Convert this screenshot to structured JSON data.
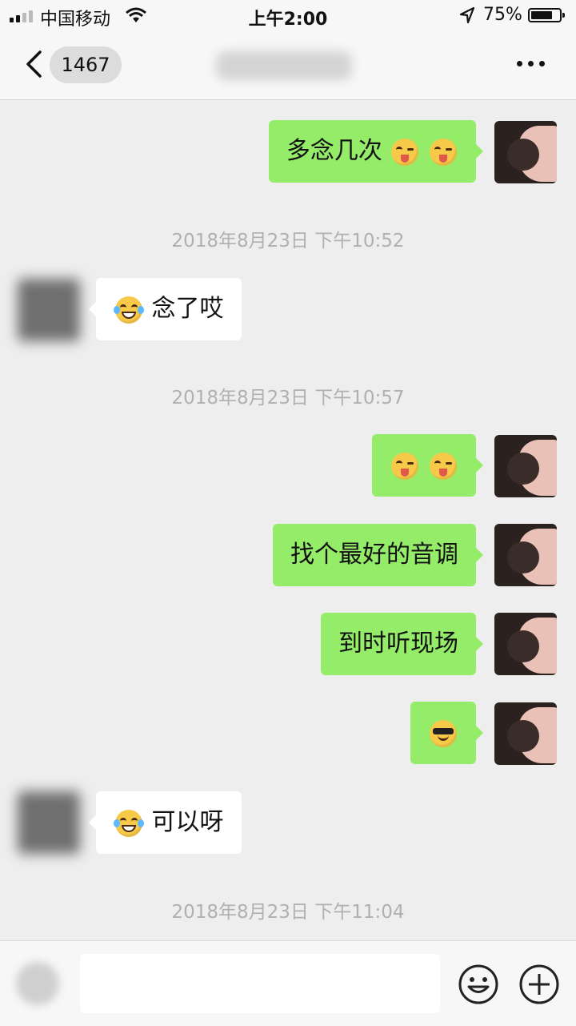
{
  "status_bar": {
    "carrier": "中国移动",
    "time": "上午2:00",
    "battery_percent": "75%",
    "battery_level": 0.75
  },
  "nav": {
    "back_badge": "1467"
  },
  "timestamps": [
    "2018年8月23日 下午10:52",
    "2018年8月23日 下午10:57",
    "2018年8月23日 下午11:04"
  ],
  "messages": [
    {
      "from": "me",
      "text": "多念几次",
      "emoji": [
        "wink-tongue",
        "wink-tongue"
      ]
    },
    {
      "from": "other",
      "text": "念了哎",
      "emoji_before": [
        "laugh-cry"
      ]
    },
    {
      "from": "me",
      "text": "",
      "emoji": [
        "wink-tongue",
        "wink-tongue"
      ]
    },
    {
      "from": "me",
      "text": "找个最好的音调"
    },
    {
      "from": "me",
      "text": "到时听现场"
    },
    {
      "from": "me",
      "text": "",
      "emoji": [
        "sunglasses"
      ]
    },
    {
      "from": "other",
      "text": "可以呀",
      "emoji_before": [
        "laugh-cry"
      ]
    }
  ],
  "input": {
    "placeholder": "",
    "emoji_button": "emoji-icon",
    "plus_button": "plus-icon"
  },
  "colors": {
    "outgoing_bubble": "#95ec69",
    "incoming_bubble": "#ffffff",
    "background": "#eeeeee"
  }
}
